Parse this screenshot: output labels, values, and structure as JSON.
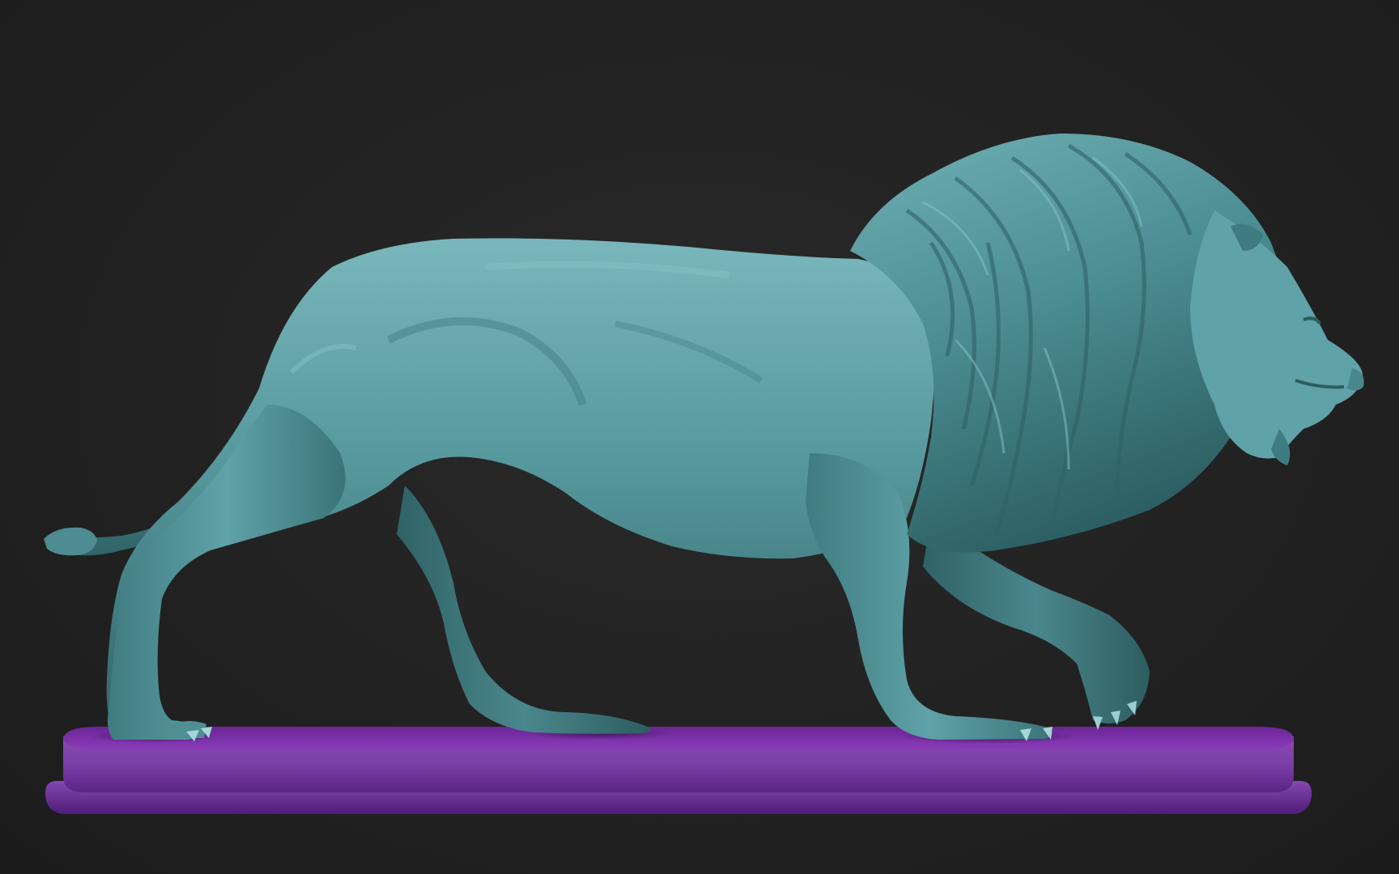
{
  "scene": {
    "subject": "lion-sculpture",
    "colors": {
      "background": "#222222",
      "lion_base": "#4f8f94",
      "lion_highlight": "#74b3b8",
      "lion_shadow": "#2c5c60",
      "pedestal_top": "#7b2fa8",
      "pedestal_side": "#6a3096",
      "pedestal_rim": "#5a2585"
    }
  }
}
